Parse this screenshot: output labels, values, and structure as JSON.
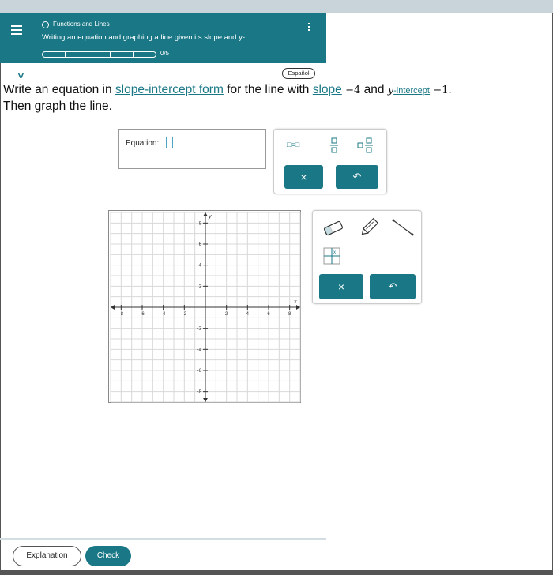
{
  "header": {
    "topic": "Functions and Lines",
    "lesson_title": "Writing an equation and graphing a line given its slope and y-...",
    "progress_text": "0/5",
    "progress_fraction": 0
  },
  "language_button": "Español",
  "question": {
    "part1": "Write an equation in ",
    "link_form": "slope-intercept form",
    "part2": " for the line with ",
    "link_slope": "slope",
    "slope_value": "−4",
    "part3": " and ",
    "y_var": "y",
    "link_intercept": "-intercept",
    "intercept_value": "−1.",
    "line2": "Then graph the line."
  },
  "equation": {
    "label": "Equation:",
    "value": ""
  },
  "equation_toolbar": {
    "templates": [
      "□=□",
      "□/□",
      "□ □/□"
    ],
    "clear_symbol": "×",
    "undo_symbol": "↶"
  },
  "graph": {
    "x_axis_label": "x",
    "y_axis_label": "y",
    "x_ticks": [
      "-8",
      "-6",
      "-4",
      "-2",
      "2",
      "4",
      "6",
      "8"
    ],
    "y_ticks": [
      "8",
      "6",
      "4",
      "2",
      "-2",
      "-4",
      "-6",
      "-8"
    ],
    "range": [
      -9,
      9
    ],
    "grid": true
  },
  "graph_toolbar": {
    "tools": [
      "eraser-tool",
      "pencil-tool",
      "line-tool",
      "table-tool"
    ],
    "clear_symbol": "×",
    "undo_symbol": "↶"
  },
  "footer": {
    "explanation_label": "Explanation",
    "check_label": "Check"
  },
  "colors": {
    "accent": "#1a7886",
    "link": "#1a7886"
  }
}
